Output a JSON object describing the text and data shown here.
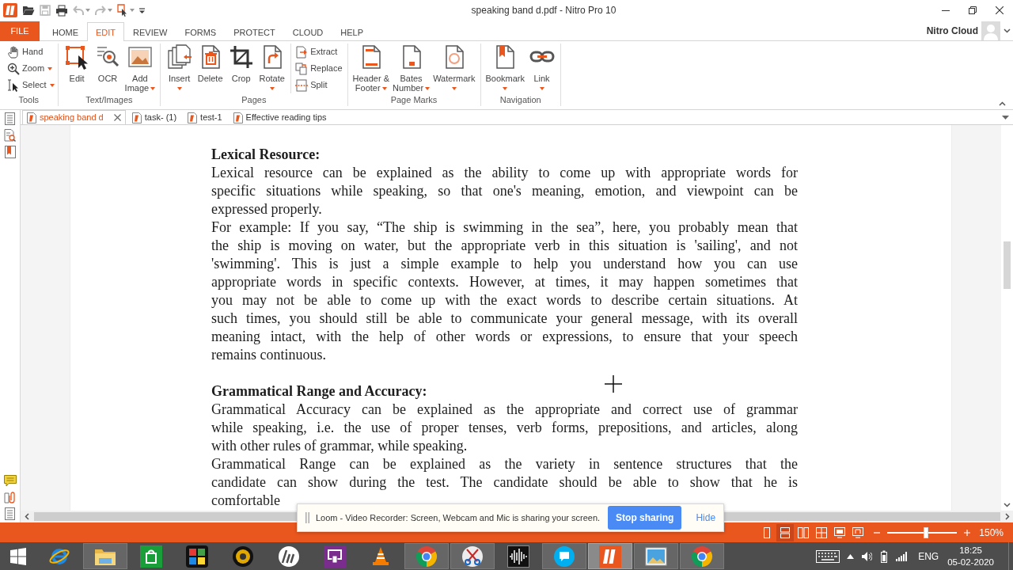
{
  "window": {
    "title": "speaking band d.pdf - Nitro Pro 10"
  },
  "quick_access": [
    {
      "disabled": false,
      "dropdown": false
    },
    {
      "disabled": true,
      "dropdown": false
    },
    {
      "disabled": false,
      "dropdown": false
    },
    {
      "disabled": true,
      "dropdown": true
    },
    {
      "disabled": true,
      "dropdown": true
    },
    {
      "disabled": false,
      "dropdown": true
    },
    {
      "disabled": false,
      "dropdown": false
    }
  ],
  "ribbon_tabs": [
    {
      "label": "FILE",
      "kind": "backstage",
      "selected": false
    },
    {
      "label": "HOME",
      "kind": "tab",
      "selected": false
    },
    {
      "label": "EDIT",
      "kind": "tab",
      "selected": true
    },
    {
      "label": "REVIEW",
      "kind": "tab",
      "selected": false
    },
    {
      "label": "FORMS",
      "kind": "tab",
      "selected": false
    },
    {
      "label": "PROTECT",
      "kind": "tab",
      "selected": false
    },
    {
      "label": "CLOUD",
      "kind": "tab",
      "selected": false
    },
    {
      "label": "HELP",
      "kind": "tab",
      "selected": false
    }
  ],
  "account": {
    "label": "Nitro Cloud"
  },
  "ribbon_groups": [
    {
      "title": "Tools",
      "items": [
        {
          "label": "Hand",
          "kind": "small",
          "dropdown": false
        },
        {
          "label": "Zoom",
          "kind": "small",
          "dropdown": true
        },
        {
          "label": "Select",
          "kind": "small",
          "dropdown": true
        }
      ]
    },
    {
      "title": "Text/Images",
      "items": [
        {
          "label": "Edit",
          "kind": "large",
          "dropdown": false
        },
        {
          "label": "OCR",
          "kind": "large",
          "dropdown": false
        },
        {
          "label": "Add Image",
          "kind": "large",
          "dropdown": true
        }
      ]
    },
    {
      "title": "Pages",
      "items": [
        {
          "label": "Insert",
          "kind": "large",
          "dropdown": true
        },
        {
          "label": "Delete",
          "kind": "large",
          "dropdown": false
        },
        {
          "label": "Crop",
          "kind": "large",
          "dropdown": false
        },
        {
          "label": "Rotate",
          "kind": "large",
          "dropdown": true
        },
        {
          "label": "Extract",
          "kind": "small",
          "dropdown": false
        },
        {
          "label": "Replace",
          "kind": "small",
          "dropdown": false
        },
        {
          "label": "Split",
          "kind": "small",
          "dropdown": false
        }
      ]
    },
    {
      "title": "Page Marks",
      "items": [
        {
          "label": "Header & Footer",
          "kind": "large",
          "dropdown": true
        },
        {
          "label": "Bates Number",
          "kind": "large",
          "dropdown": true
        },
        {
          "label": "Watermark",
          "kind": "large",
          "dropdown": true
        }
      ]
    },
    {
      "title": "Navigation",
      "items": [
        {
          "label": "Bookmark",
          "kind": "large",
          "dropdown": true
        },
        {
          "label": "Link",
          "kind": "large",
          "dropdown": true
        }
      ]
    }
  ],
  "doc_tabs": [
    {
      "label": "speaking band d",
      "selected": true,
      "closable": true
    },
    {
      "label": "task- (1)",
      "selected": false,
      "closable": false
    },
    {
      "label": "test-1",
      "selected": false,
      "closable": false
    },
    {
      "label": "Effective reading tips",
      "selected": false,
      "closable": false
    }
  ],
  "document": {
    "blocks": [
      {
        "kind": "heading",
        "text": "Lexical Resource:"
      },
      {
        "kind": "paragraph",
        "lines": [
          "Lexical resource can be explained as the ability to come up with appropriate words for",
          "specific situations while speaking, so that one's meaning, emotion, and viewpoint can be",
          "expressed properly."
        ]
      },
      {
        "kind": "paragraph",
        "lines": [
          "For example: If you say, “The ship is swimming in the sea”, here, you probably mean that",
          "the ship is moving on water, but the appropriate verb in this situation is 'sailing', and not",
          "'swimming'. This is just a simple example to help you understand how you can use",
          "appropriate words in specific contexts. However, at times, it may happen sometimes that",
          "you may not be able to come up with the exact words to describe certain situations. At",
          "such times, you should still be able to communicate your general message, with its overall",
          "meaning intact, with the help of other words or expressions, to ensure that your speech",
          "remains continuous."
        ]
      },
      {
        "kind": "heading",
        "text": "Grammatical Range and Accuracy:"
      },
      {
        "kind": "paragraph",
        "lines": [
          "Grammatical Accuracy can be explained as the appropriate and correct use of grammar",
          "while speaking, i.e. the use of proper tenses, verb forms, prepositions, and articles, along",
          "with other rules of grammar, while speaking."
        ]
      },
      {
        "kind": "paragraph",
        "lines": [
          "Grammatical Range can be explained as the variety in sentence structures that the",
          "candidate can show during the test. The candidate should be able to show that he is",
          "comfortable"
        ]
      }
    ]
  },
  "notification": {
    "message": "Loom - Video Recorder: Screen, Webcam and Mic is sharing your screen.",
    "action": "Stop sharing",
    "dismiss": "Hide"
  },
  "status_bar": {
    "view_modes": [
      {
        "selected": false
      },
      {
        "selected": true
      },
      {
        "selected": false
      },
      {
        "selected": false
      },
      {
        "selected": false
      },
      {
        "selected": false
      }
    ],
    "zoom": {
      "level": 0.55,
      "reading": "150%"
    }
  },
  "taskbar": {
    "apps": [
      {
        "running": false,
        "selected": false
      },
      {
        "running": true,
        "selected": false
      },
      {
        "running": false,
        "selected": false
      },
      {
        "running": false,
        "selected": false
      },
      {
        "running": false,
        "selected": false
      },
      {
        "running": false,
        "selected": false
      },
      {
        "running": false,
        "selected": false
      },
      {
        "running": false,
        "selected": false
      },
      {
        "running": true,
        "selected": false
      },
      {
        "running": true,
        "selected": false
      },
      {
        "running": false,
        "selected": false
      },
      {
        "running": true,
        "selected": false
      },
      {
        "running": true,
        "selected": true
      },
      {
        "running": true,
        "selected": false
      },
      {
        "running": true,
        "selected": false
      }
    ],
    "language": "ENG",
    "time": "18:25",
    "date": "05-02-2020"
  }
}
